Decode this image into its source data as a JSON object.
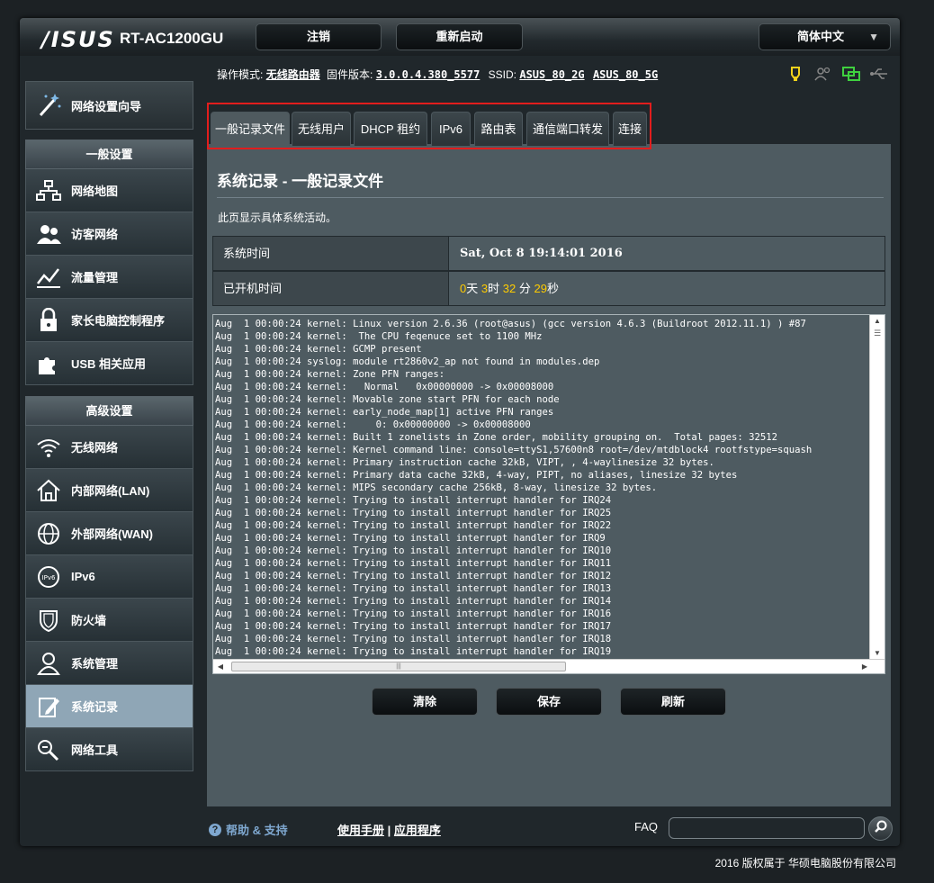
{
  "header": {
    "logo": "/ISUS",
    "model": "RT-AC1200GU",
    "logout_label": "注销",
    "reboot_label": "重新启动",
    "language": "简体中文"
  },
  "infobar": {
    "mode_label": "操作模式:",
    "mode_value": "无线路由器",
    "firmware_label": "固件版本:",
    "firmware_value": "3.0.0.4.380_5577",
    "ssid_label": "SSID:",
    "ssid_2g": "ASUS_80_2G",
    "ssid_5g": "ASUS_80_5G"
  },
  "sidebar": {
    "wizard": "网络设置向导",
    "general_head": "一般设置",
    "general_items": [
      "网络地图",
      "访客网络",
      "流量管理",
      "家长电脑控制程序",
      "USB 相关应用"
    ],
    "advanced_head": "高级设置",
    "advanced_items": [
      "无线网络",
      "内部网络(LAN)",
      "外部网络(WAN)",
      "IPv6",
      "防火墙",
      "系统管理",
      "系统记录",
      "网络工具"
    ]
  },
  "tabs": [
    "一般记录文件",
    "无线用户",
    "DHCP 租约",
    "IPv6",
    "路由表",
    "通信端口转发",
    "连接"
  ],
  "panel": {
    "title": "系统记录 - 一般记录文件",
    "description": "此页显示具体系统活动。",
    "system_time_label": "系统时间",
    "system_time_value": "Sat, Oct 8  19:14:01 2016",
    "uptime_label": "已开机时间",
    "uptime": {
      "days": "0",
      "days_unit": "天",
      "hours": "3",
      "hours_unit": "时",
      "minutes": "32",
      "minutes_unit": "分",
      "seconds": "29",
      "seconds_unit": "秒"
    }
  },
  "log_lines": [
    "Aug  1 00:00:24 kernel: Linux version 2.6.36 (root@asus) (gcc version 4.6.3 (Buildroot 2012.11.1) ) #87",
    "Aug  1 00:00:24 kernel:  The CPU feqenuce set to 1100 MHz",
    "Aug  1 00:00:24 kernel: GCMP present",
    "Aug  1 00:00:24 syslog: module rt2860v2_ap not found in modules.dep",
    "Aug  1 00:00:24 kernel: Zone PFN ranges:",
    "Aug  1 00:00:24 kernel:   Normal   0x00000000 -> 0x00008000",
    "Aug  1 00:00:24 kernel: Movable zone start PFN for each node",
    "Aug  1 00:00:24 kernel: early_node_map[1] active PFN ranges",
    "Aug  1 00:00:24 kernel:     0: 0x00000000 -> 0x00008000",
    "Aug  1 00:00:24 kernel: Built 1 zonelists in Zone order, mobility grouping on.  Total pages: 32512",
    "Aug  1 00:00:24 kernel: Kernel command line: console=ttyS1,57600n8 root=/dev/mtdblock4 rootfstype=squash",
    "Aug  1 00:00:24 kernel: Primary instruction cache 32kB, VIPT, , 4-waylinesize 32 bytes.",
    "Aug  1 00:00:24 kernel: Primary data cache 32kB, 4-way, PIPT, no aliases, linesize 32 bytes",
    "Aug  1 00:00:24 kernel: MIPS secondary cache 256kB, 8-way, linesize 32 bytes.",
    "Aug  1 00:00:24 kernel: Trying to install interrupt handler for IRQ24",
    "Aug  1 00:00:24 kernel: Trying to install interrupt handler for IRQ25",
    "Aug  1 00:00:24 kernel: Trying to install interrupt handler for IRQ22",
    "Aug  1 00:00:24 kernel: Trying to install interrupt handler for IRQ9",
    "Aug  1 00:00:24 kernel: Trying to install interrupt handler for IRQ10",
    "Aug  1 00:00:24 kernel: Trying to install interrupt handler for IRQ11",
    "Aug  1 00:00:24 kernel: Trying to install interrupt handler for IRQ12",
    "Aug  1 00:00:24 kernel: Trying to install interrupt handler for IRQ13",
    "Aug  1 00:00:24 kernel: Trying to install interrupt handler for IRQ14",
    "Aug  1 00:00:24 kernel: Trying to install interrupt handler for IRQ16",
    "Aug  1 00:00:24 kernel: Trying to install interrupt handler for IRQ17",
    "Aug  1 00:00:24 kernel: Trying to install interrupt handler for IRQ18",
    "Aug  1 00:00:24 kernel: Trying to install interrupt handler for IRQ19"
  ],
  "actions": {
    "clear": "清除",
    "save": "保存",
    "refresh": "刷新"
  },
  "footer": {
    "help": "帮助 & 支持",
    "manual": "使用手册",
    "separator": "|",
    "app": "应用程序",
    "faq": "FAQ",
    "copyright": "2016 版权属于 华硕电脑股份有限公司"
  },
  "colors": {
    "highlight_border": "#e21d1d",
    "uptime_numbers": "#ffcc00",
    "active_sidebar": "#8fa6b6"
  }
}
